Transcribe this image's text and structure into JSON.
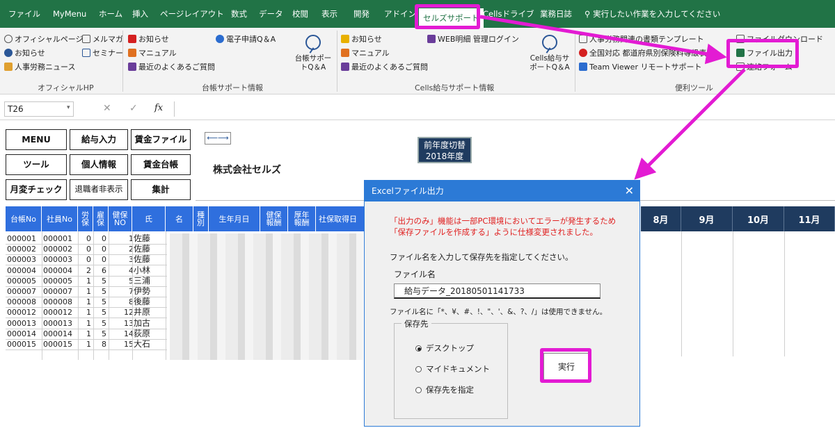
{
  "tabs": [
    "ファイル",
    "MyMenu",
    "ホーム",
    "挿入",
    "ページレイアウト",
    "数式",
    "データ",
    "校閲",
    "表示",
    "開発",
    "アドイン",
    "セルズサポート",
    "Cellsドライブ",
    "業務日誌"
  ],
  "tell_me": "実行したい作業を入力してください",
  "ribbon": {
    "official": [
      "オフィシャルページ",
      "メルマガ",
      "お知らせ",
      "セミナー",
      "人事労務ニュース"
    ],
    "group_official": "オフィシャルHP",
    "daicho": [
      "お知らせ",
      "マニュアル",
      "最近のよくあるご質問",
      "電子申請Q＆A"
    ],
    "daicho_big": [
      "台帳サポー",
      "トQ＆A"
    ],
    "group_daicho": "台帳サポート情報",
    "cells": [
      "お知らせ",
      "マニュアル",
      "最近のよくあるご質問",
      "WEB明細 管理ログイン"
    ],
    "cells_big": [
      "Cells給与サ",
      "ポートQ＆A"
    ],
    "group_cells": "Cells給与サポート情報",
    "tools": [
      "人事労務関連の書類テンプレート",
      "全国対応 都道府県別保険料等級表",
      "Team Viewer リモートサポート",
      "ファイルダウンロード",
      "ファイル出力",
      "連絡フォーム"
    ],
    "group_tools": "便利ツール"
  },
  "namebox": "T26",
  "fx": "fx",
  "sheet": {
    "buttons": [
      "MENU",
      "給与入力",
      "賃金ファイル",
      "ツール",
      "個人情報",
      "賃金台帳",
      "月変チェック",
      "退職者非表示",
      "集計"
    ],
    "company": "株式会社セルズ",
    "year_btn": [
      "前年度切替",
      "2018年度"
    ],
    "headers": [
      "台帳No",
      "社員No",
      "労保",
      "雇保",
      "健保NO",
      "氏",
      "名",
      "種別",
      "生年月日",
      "健保報酬",
      "厚年報酬",
      "社保取得日"
    ],
    "months": [
      "8月",
      "9月",
      "10月",
      "11月"
    ],
    "rows": [
      [
        "000001",
        "000001",
        "0",
        "0",
        "1",
        "佐藤"
      ],
      [
        "000002",
        "000002",
        "0",
        "0",
        "2",
        "佐藤"
      ],
      [
        "000003",
        "000003",
        "0",
        "0",
        "3",
        "佐藤"
      ],
      [
        "000004",
        "000004",
        "2",
        "6",
        "4",
        "小林"
      ],
      [
        "000005",
        "000005",
        "1",
        "5",
        "5",
        "三浦"
      ],
      [
        "000007",
        "000007",
        "1",
        "5",
        "7",
        "伊勢"
      ],
      [
        "000008",
        "000008",
        "1",
        "5",
        "8",
        "後藤"
      ],
      [
        "000012",
        "000012",
        "1",
        "5",
        "12",
        "井原"
      ],
      [
        "000013",
        "000013",
        "1",
        "5",
        "13",
        "加古"
      ],
      [
        "000014",
        "000014",
        "1",
        "5",
        "14",
        "荻原"
      ],
      [
        "000015",
        "000015",
        "1",
        "8",
        "15",
        "大石"
      ]
    ]
  },
  "dialog": {
    "title": "Excelファイル出力",
    "close": "✕",
    "warn1": "「出力のみ」機能は一部PC環境においてエラーが発生するため",
    "warn2": "「保存ファイルを作成する」ように仕様変更されました。",
    "instruction": "ファイル名を入力して保存先を指定してください。",
    "fname_label": "ファイル名",
    "fname_value": "給与データ_20180501141733",
    "note": "ファイル名に「*、¥、#、!、\"、'、&、?、/」は使用できません。",
    "save_label": "保存先",
    "options": [
      "デスクトップ",
      "マイドキュメント",
      "保存先を指定"
    ],
    "selected": 0,
    "run": "実行"
  },
  "colors": {
    "excel_green": "#217346",
    "highlight": "#e31bd3",
    "header_blue": "#2f6fde",
    "dialog_blue": "#2c7ad6",
    "month_header": "#1f3b5f"
  }
}
